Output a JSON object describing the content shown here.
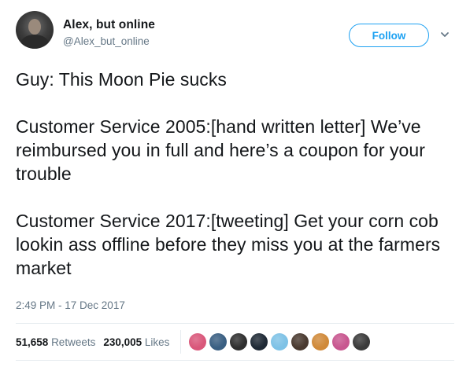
{
  "author": {
    "display_name": "Alex, but online",
    "handle": "@Alex_but_online",
    "avatar_icon": "profile-photo-avatar"
  },
  "follow_button": {
    "label": "Follow",
    "color": "#1da1f2"
  },
  "menu": {
    "icon": "chevron-down-icon"
  },
  "tweet": {
    "text": "Guy: This Moon Pie sucks\n\nCustomer Service 2005:[hand written letter] We’ve reimbursed you in full and here’s a coupon for your trouble\n\nCustomer Service 2017:[tweeting] Get your corn cob lookin ass offline before they miss you at the farmers market",
    "timestamp": "2:49 PM - 17 Dec 2017"
  },
  "stats": {
    "retweets_count": "51,658",
    "retweets_label": "Retweets",
    "likes_count": "230,005",
    "likes_label": "Likes"
  },
  "likers": [
    {
      "name": "liker-avatar-1",
      "color": "#d9577a"
    },
    {
      "name": "liker-avatar-2",
      "color": "#3a5f82"
    },
    {
      "name": "liker-avatar-3",
      "color": "#2f2f2f"
    },
    {
      "name": "liker-avatar-4",
      "color": "#1f2a36"
    },
    {
      "name": "liker-avatar-5",
      "color": "#7ec2e6"
    },
    {
      "name": "liker-avatar-6",
      "color": "#4a3a30"
    },
    {
      "name": "liker-avatar-7",
      "color": "#d08a3a"
    },
    {
      "name": "liker-avatar-8",
      "color": "#c8568f"
    },
    {
      "name": "liker-avatar-9",
      "color": "#3b3b3b"
    }
  ],
  "colors": {
    "text": "#14171a",
    "secondary_text": "#657786",
    "divider": "#e6ecf0"
  }
}
